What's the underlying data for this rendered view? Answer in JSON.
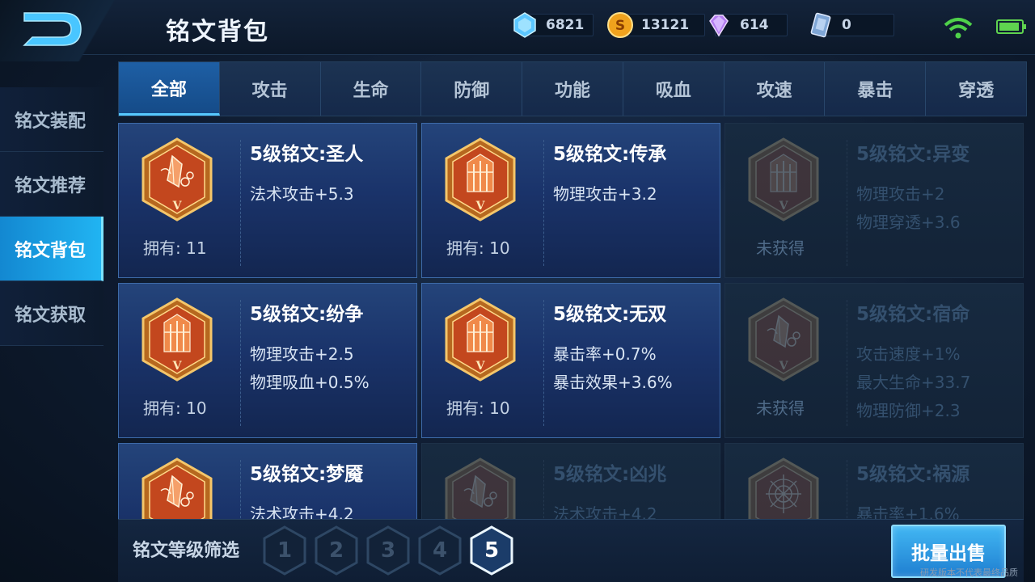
{
  "header": {
    "title": "铭文背包",
    "currencies": [
      {
        "icon": "diamond-icon",
        "value": "6821"
      },
      {
        "icon": "gold-coin-icon",
        "value": "13121"
      },
      {
        "icon": "gem-icon",
        "value": "614"
      },
      {
        "icon": "voucher-icon",
        "value": "0"
      }
    ]
  },
  "sidebar": {
    "items": [
      {
        "label": "铭文装配",
        "active": false
      },
      {
        "label": "铭文推荐",
        "active": false
      },
      {
        "label": "铭文背包",
        "active": true
      },
      {
        "label": "铭文获取",
        "active": false
      }
    ]
  },
  "tabs": [
    "全部",
    "攻击",
    "生命",
    "防御",
    "功能",
    "吸血",
    "攻速",
    "暴击",
    "穿透"
  ],
  "active_tab": "全部",
  "cards": [
    {
      "name": "5级铭文:圣人",
      "stats": [
        "法术攻击+5.3"
      ],
      "owned": "拥有: 11",
      "locked": false,
      "emblem": "crystal"
    },
    {
      "name": "5级铭文:传承",
      "stats": [
        "物理攻击+3.2"
      ],
      "owned": "拥有: 10",
      "locked": false,
      "emblem": "gate"
    },
    {
      "name": "5级铭文:异变",
      "stats": [
        "物理攻击+2",
        "物理穿透+3.6"
      ],
      "owned": "未获得",
      "locked": true,
      "emblem": "gate"
    },
    {
      "name": "5级铭文:纷争",
      "stats": [
        "物理攻击+2.5",
        "物理吸血+0.5%"
      ],
      "owned": "拥有: 10",
      "locked": false,
      "emblem": "gate"
    },
    {
      "name": "5级铭文:无双",
      "stats": [
        "暴击率+0.7%",
        "暴击效果+3.6%"
      ],
      "owned": "拥有: 10",
      "locked": false,
      "emblem": "gate"
    },
    {
      "name": "5级铭文:宿命",
      "stats": [
        "攻击速度+1%",
        "最大生命+33.7",
        "物理防御+2.3"
      ],
      "owned": "未获得",
      "locked": true,
      "emblem": "crystal"
    },
    {
      "name": "5级铭文:梦魇",
      "stats": [
        "法术攻击+4.2"
      ],
      "owned": "",
      "locked": false,
      "emblem": "crystal"
    },
    {
      "name": "5级铭文:凶兆",
      "stats": [
        "法术攻击+4.2"
      ],
      "owned": "",
      "locked": true,
      "emblem": "crystal"
    },
    {
      "name": "5级铭文:祸源",
      "stats": [
        "暴击率+1.6%"
      ],
      "owned": "",
      "locked": true,
      "emblem": "web"
    }
  ],
  "bottom": {
    "filter_label": "铭文等级筛选",
    "levels": [
      "1",
      "2",
      "3",
      "4",
      "5"
    ],
    "active_level": "5",
    "sell_label": "批量出售",
    "watermark": "研发版本不代表最终品质"
  },
  "colors": {
    "accent": "#21b4f2",
    "card_bg": "#1a336a",
    "emblem_orange": "#d9622a"
  }
}
